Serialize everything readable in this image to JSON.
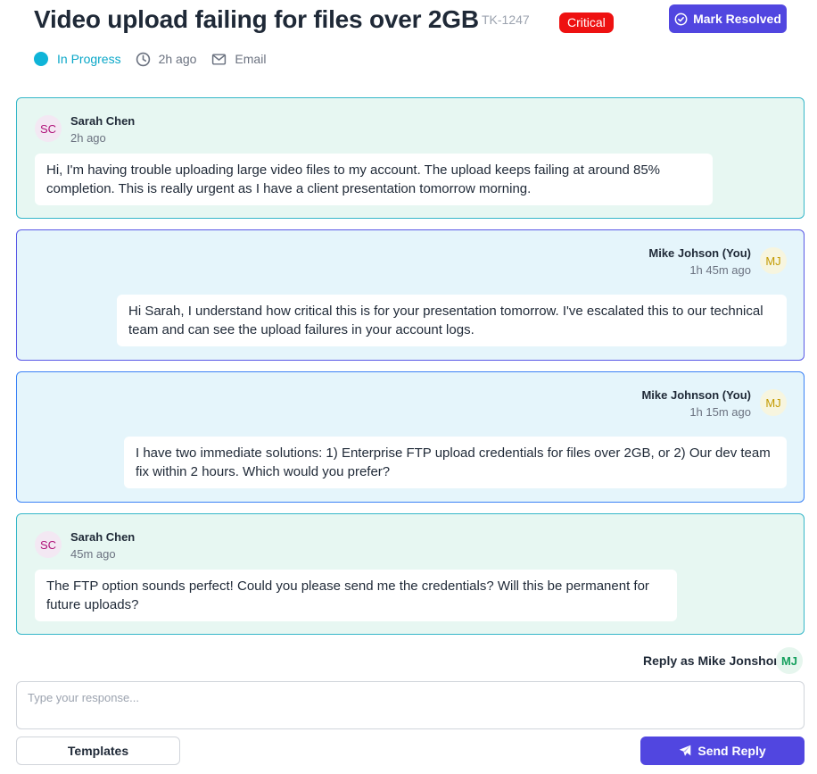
{
  "ticket": {
    "title": "Video upload failing for files over 2GB",
    "id": "TK-1247",
    "priority": "Critical",
    "resolve_label": "Mark Resolved"
  },
  "meta": {
    "status": "In Progress",
    "age": "2h ago",
    "channel": "Email"
  },
  "messages": [
    {
      "role": "customer",
      "initials": "SC",
      "sender": "Sarah Chen",
      "time": "2h ago",
      "text": "Hi, I'm having trouble uploading large video files to my account. The upload keeps failing at around 85% completion. This is really urgent as I have a client presentation tomorrow morning."
    },
    {
      "role": "agent",
      "initials": "MJ",
      "sender": "Mike Johson (You)",
      "time": "1h 45m ago",
      "text": "Hi Sarah, I understand how critical this is for your presentation tomorrow. I've escalated this to our technical team and can see the upload failures in your account logs."
    },
    {
      "role": "agent",
      "initials": "MJ",
      "sender": "Mike Johnson (You)",
      "time": "1h 15m ago",
      "text": "I have two immediate solutions: 1) Enterprise FTP upload credentials for files over 2GB, or 2) Our dev team fix within 2 hours. Which would you prefer?"
    },
    {
      "role": "customer",
      "initials": "SC",
      "sender": "Sarah Chen",
      "time": "45m ago",
      "text": "The FTP option sounds perfect! Could you please send me the credentials? Will this be permanent for future uploads?"
    }
  ],
  "reply": {
    "reply_as": "Reply as Mike Jonshon",
    "initials": "MJ",
    "placeholder": "Type your response...",
    "templates_label": "Templates",
    "send_label": "Send Reply"
  },
  "colors": {
    "accent": "#5146e0",
    "critical": "#ee1111",
    "status": "#0fb4d8"
  }
}
